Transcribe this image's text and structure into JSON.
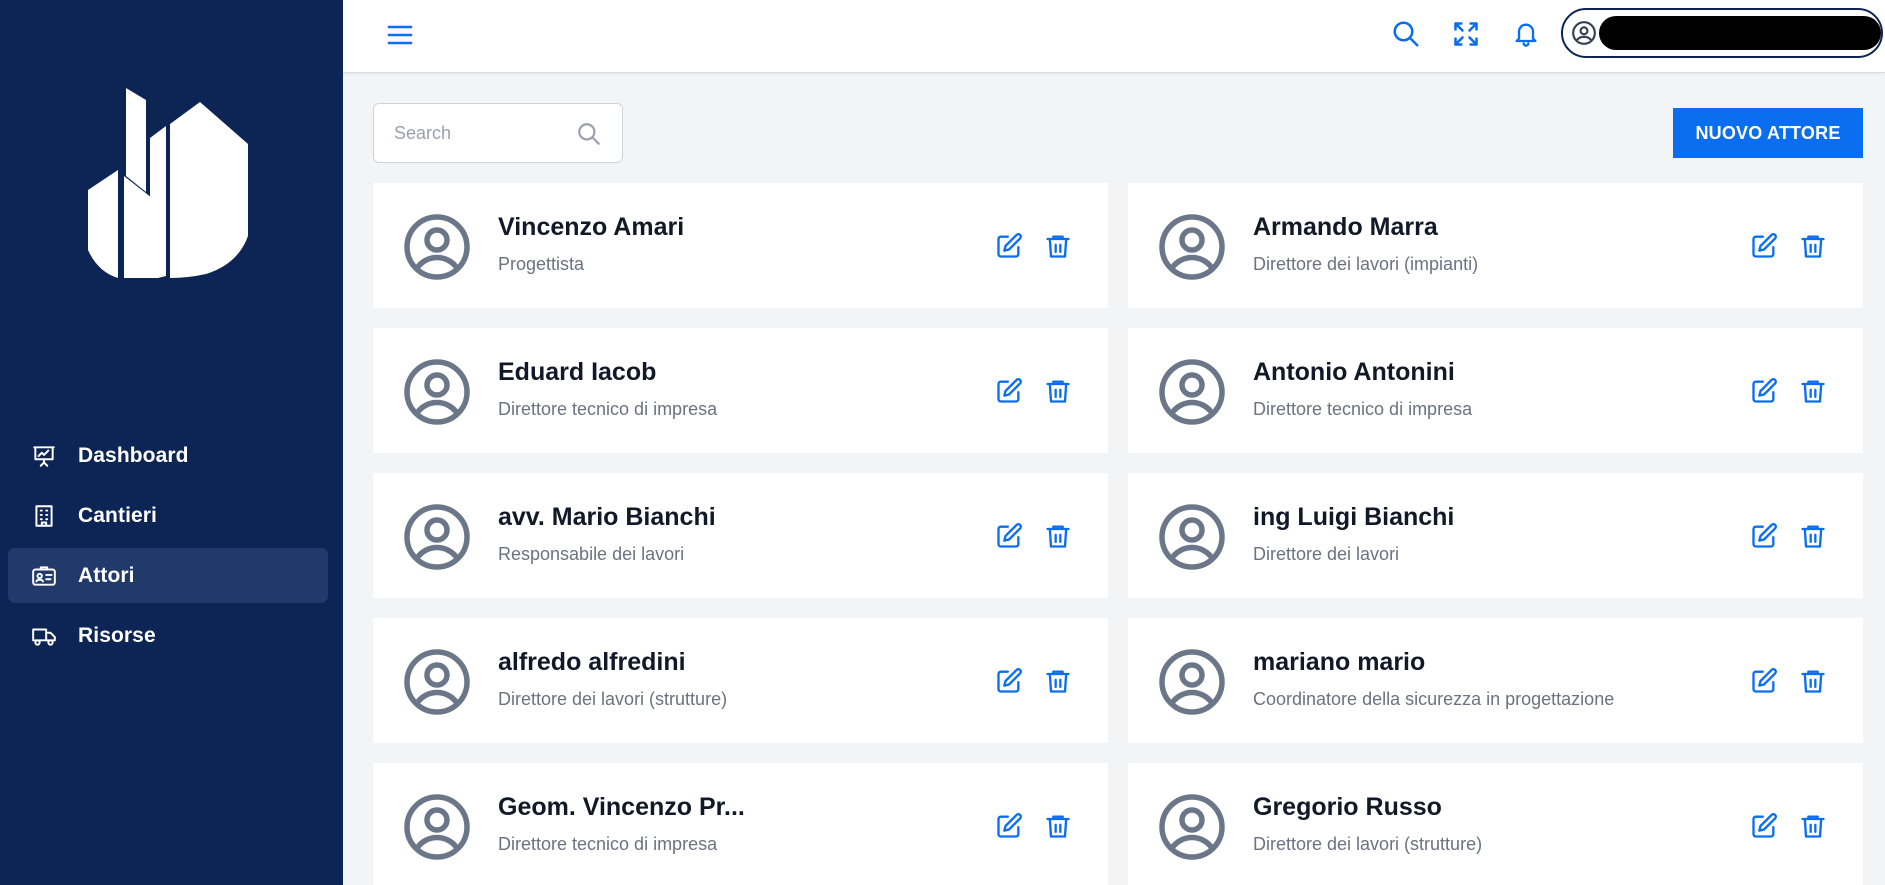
{
  "sidebar": {
    "items": [
      {
        "label": "Dashboard",
        "icon": "presentation-chart-icon",
        "active": false
      },
      {
        "label": "Cantieri",
        "icon": "building-icon",
        "active": false
      },
      {
        "label": "Attori",
        "icon": "id-card-icon",
        "active": true
      },
      {
        "label": "Risorse",
        "icon": "truck-icon",
        "active": false
      }
    ]
  },
  "search": {
    "placeholder": "Search",
    "value": ""
  },
  "toolbar": {
    "new_label": "NUOVO ATTORE"
  },
  "actors": [
    {
      "name": "Vincenzo Amari",
      "role": "Progettista"
    },
    {
      "name": "Armando Marra",
      "role": "Direttore dei lavori (impianti)"
    },
    {
      "name": "Eduard Iacob",
      "role": "Direttore tecnico di impresa"
    },
    {
      "name": "Antonio Antonini",
      "role": "Direttore tecnico di impresa"
    },
    {
      "name": "avv. Mario Bianchi",
      "role": "Responsabile dei lavori"
    },
    {
      "name": "ing Luigi Bianchi",
      "role": "Direttore dei lavori"
    },
    {
      "name": "alfredo alfredini",
      "role": "Direttore dei lavori (strutture)"
    },
    {
      "name": "mariano mario",
      "role": "Coordinatore della sicurezza in progettazione"
    },
    {
      "name": "Geom. Vincenzo Pr...",
      "role": "Direttore tecnico di impresa"
    },
    {
      "name": "Gregorio Russo",
      "role": "Direttore dei lavori (strutture)"
    }
  ],
  "colors": {
    "sidebar": "#0d2554",
    "accent": "#0b6ef0",
    "avatar": "#6b7789"
  }
}
